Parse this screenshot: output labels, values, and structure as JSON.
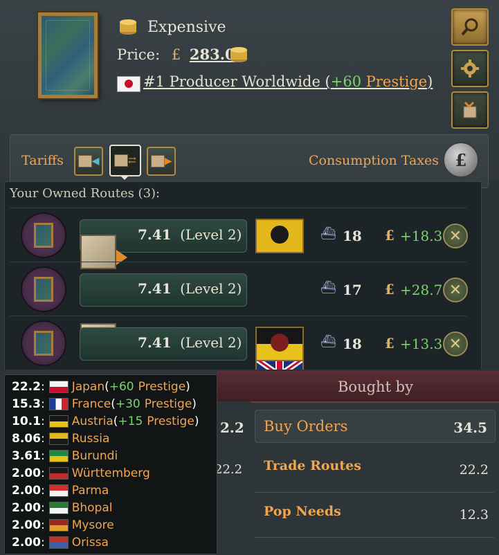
{
  "goods": {
    "tier": "Expensive",
    "price_label": "Price:",
    "currency": "£",
    "price": "283.0",
    "rank_text": "#1 Producer Worldwide (",
    "rank_bonus": "+60",
    "rank_prestige": " Prestige",
    "rank_close": ")"
  },
  "tariffs": {
    "label": "Tariffs",
    "consumption_label": "Consumption Taxes",
    "pound_symbol": "£"
  },
  "routes": {
    "title": "Your Owned Routes (3):",
    "items": [
      {
        "value": "7.41",
        "level": "(Level 2)",
        "flag": "russia",
        "convoys": "18",
        "currency": "£",
        "profit": "+18.3"
      },
      {
        "value": "7.41",
        "level": "(Level 2)",
        "flag": "great-britain",
        "convoys": "17",
        "currency": "£",
        "profit": "+28.7"
      },
      {
        "value": "7.41",
        "level": "(Level 2)",
        "flag": "austria",
        "convoys": "18",
        "currency": "£",
        "profit": "+13.3"
      }
    ]
  },
  "bought_by": {
    "title": "Bought by",
    "buy_orders_label": "Buy Orders",
    "buy_orders_value": "34.5",
    "trade_routes_label": "Trade Routes",
    "trade_routes_value": "22.2",
    "pop_needs_label": "Pop Needs",
    "pop_needs_value": "12.3"
  },
  "sold_partial": {
    "top": "2.2",
    "mid": "22.2"
  },
  "tooltip": [
    {
      "value": "22.2",
      "country": "Japan",
      "bonus_open": " (",
      "bonus": "+60",
      "prestige": "Prestige",
      "bonus_close": ")",
      "flag_colors": [
        "#f4f4f4",
        "#c8102e"
      ]
    },
    {
      "value": "15.3",
      "country": "France",
      "bonus_open": " (",
      "bonus": "+30",
      "prestige": "Prestige",
      "bonus_close": ")",
      "flag_colors": [
        "#1d3b9a",
        "#ffffff",
        "#d1232a"
      ]
    },
    {
      "value": "10.1",
      "country": "Austria",
      "bonus_open": " (",
      "bonus": "+15",
      "prestige": "Prestige",
      "bonus_close": ")",
      "flag_colors": [
        "#161616",
        "#e7c21d"
      ]
    },
    {
      "value": "8.06",
      "country": "Russia",
      "flag_colors": [
        "#e3b81d",
        "#1a1a1a"
      ]
    },
    {
      "value": "3.61",
      "country": "Burundi",
      "flag_colors": [
        "#1f8a3b",
        "#e7c21d"
      ]
    },
    {
      "value": "2.00",
      "country": "Württemberg",
      "flag_colors": [
        "#1a1a1a",
        "#c22b2b"
      ]
    },
    {
      "value": "2.00",
      "country": "Parma",
      "flag_colors": [
        "#d22e2e",
        "#f2f2f2"
      ]
    },
    {
      "value": "2.00",
      "country": "Bhopal",
      "flag_colors": [
        "#2b7a3a",
        "#f2f2f2"
      ]
    },
    {
      "value": "2.00",
      "country": "Mysore",
      "flag_colors": [
        "#9b2a1e",
        "#e0a030"
      ]
    },
    {
      "value": "2.00",
      "country": "Orissa",
      "flag_colors": [
        "#b5352a",
        "#3b5fa8"
      ]
    }
  ]
}
